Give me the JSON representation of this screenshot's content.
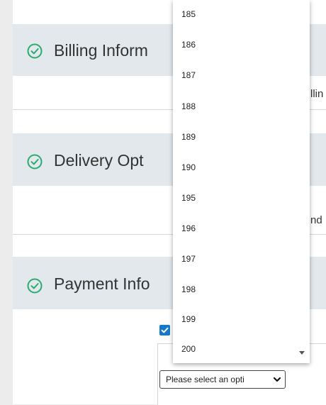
{
  "sections": {
    "billing": {
      "title": "Billing Inform",
      "side_text": "llin"
    },
    "delivery": {
      "title": "Delivery Opt",
      "side_text": "nd"
    },
    "payment": {
      "title": "Payment Info"
    }
  },
  "select": {
    "value": "Please select an opti"
  },
  "dropdown": {
    "options": [
      "185",
      "186",
      "187",
      "188",
      "189",
      "190",
      "195",
      "196",
      "197",
      "198",
      "199",
      "200"
    ]
  },
  "colors": {
    "accent": "#2bab6f",
    "section_bg": "#e2e8ec",
    "checkbox": "#1479cc"
  }
}
